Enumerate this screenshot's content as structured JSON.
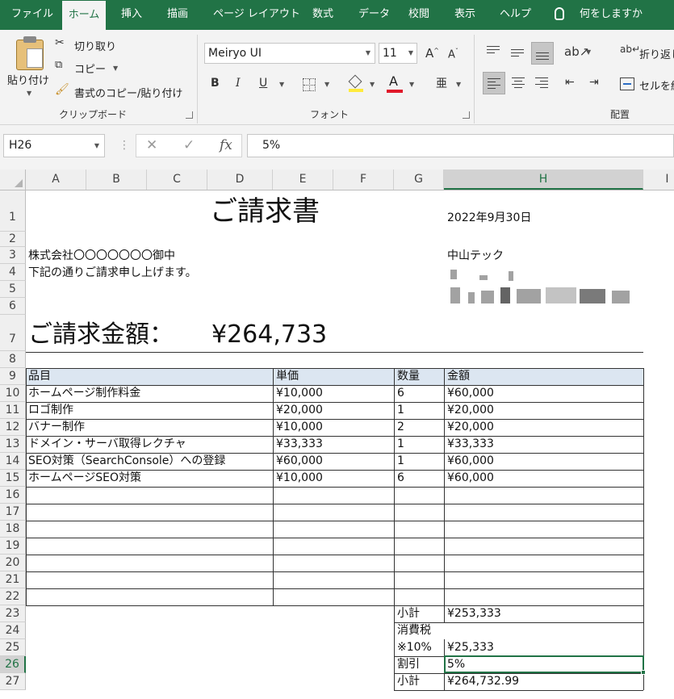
{
  "ribbon_tabs": [
    "ファイル",
    "ホーム",
    "挿入",
    "描画",
    "ページ レイアウト",
    "数式",
    "データ",
    "校閲",
    "表示",
    "ヘルプ"
  ],
  "tell_me": "何をしますか",
  "clipboard": {
    "paste": "貼り付け",
    "cut": "切り取り",
    "copy": "コピー",
    "format_painter": "書式のコピー/貼り付け",
    "group_label": "クリップボード"
  },
  "font": {
    "name": "Meiryo UI",
    "size": "11",
    "bold": "B",
    "italic": "I",
    "underline": "U",
    "color_letter": "A",
    "group_label": "フォント"
  },
  "alignment": {
    "wrap_text": "折り返し",
    "merge": "セルを結",
    "group_label": "配置"
  },
  "formula_bar": {
    "name_box": "H26",
    "fx": "fx",
    "value": "5%"
  },
  "columns": [
    "A",
    "B",
    "C",
    "D",
    "E",
    "F",
    "G",
    "H",
    "I"
  ],
  "selected_column": "H",
  "rows": [
    "1",
    "2",
    "3",
    "4",
    "5",
    "6",
    "7",
    "8",
    "9",
    "10",
    "11",
    "12",
    "13",
    "14",
    "15",
    "16",
    "17",
    "18",
    "19",
    "20",
    "21",
    "22",
    "23",
    "24",
    "25",
    "26",
    "27"
  ],
  "selected_row": "26",
  "invoice": {
    "title": "ご請求書",
    "date": "2022年9月30日",
    "client": "株式会社〇〇〇〇〇〇〇御中",
    "greeting": "下記の通りご請求申し上げます。",
    "issuer": "中山テック",
    "amount_label": "ご請求金額：",
    "amount_value": "¥264,733",
    "table_headers": [
      "品目",
      "単価",
      "数量",
      "金額"
    ],
    "items": [
      {
        "name": "ホームページ制作料金",
        "price": "¥10,000",
        "qty": "6",
        "amount": "¥60,000"
      },
      {
        "name": "ロゴ制作",
        "price": "¥20,000",
        "qty": "1",
        "amount": "¥20,000"
      },
      {
        "name": "バナー制作",
        "price": "¥10,000",
        "qty": "2",
        "amount": "¥20,000"
      },
      {
        "name": "ドメイン・サーバ取得レクチャ",
        "price": "¥33,333",
        "qty": "1",
        "amount": "¥33,333"
      },
      {
        "name": "SEO対策（SearchConsole）への登録",
        "price": "¥60,000",
        "qty": "1",
        "amount": "¥60,000"
      },
      {
        "name": "ホームページSEO対策",
        "price": "¥10,000",
        "qty": "6",
        "amount": "¥60,000"
      }
    ],
    "subtotal_label": "小計",
    "subtotal_value": "¥253,333",
    "tax_label_1": "消費税",
    "tax_label_2": "※10%",
    "tax_value": "¥25,333",
    "discount_label": "割引",
    "discount_value": "5%",
    "total_label": "小計",
    "total_value": "¥264,732.99"
  }
}
